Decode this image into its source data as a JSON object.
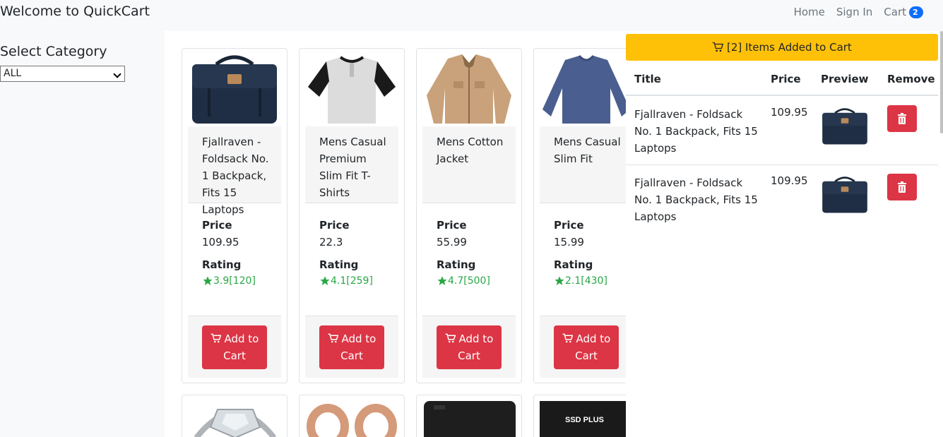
{
  "navbar": {
    "brand": "Welcome to QuickCart",
    "home": "Home",
    "sign_in": "Sign In",
    "cart": "Cart",
    "cart_count": "2"
  },
  "sidebar": {
    "title": "Select Category",
    "selected": "ALL"
  },
  "products": [
    {
      "title": "Fjallraven - Foldsack No. 1 Backpack, Fits 15 Laptops",
      "price_label": "Price",
      "price": "109.95",
      "rating_label": "Rating",
      "rating": "3.9[120]",
      "button": "Add to Cart",
      "image": "backpack"
    },
    {
      "title": "Mens Casual Premium Slim Fit T-Shirts",
      "price_label": "Price",
      "price": "22.3",
      "rating_label": "Rating",
      "rating": "4.1[259]",
      "button": "Add to Cart",
      "image": "tshirt"
    },
    {
      "title": "Mens Cotton Jacket",
      "price_label": "Price",
      "price": "55.99",
      "rating_label": "Rating",
      "rating": "4.7[500]",
      "button": "Add to Cart",
      "image": "jacket"
    },
    {
      "title": "Mens Casual Slim Fit",
      "price_label": "Price",
      "price": "15.99",
      "rating_label": "Rating",
      "rating": "2.1[430]",
      "button": "Add to Cart",
      "image": "longsleeve"
    }
  ],
  "second_row": [
    {
      "image": "ring"
    },
    {
      "image": "gold-rings"
    },
    {
      "image": "hard-drive"
    },
    {
      "image": "ssd",
      "label": "SSD PLUS"
    }
  ],
  "cart_panel": {
    "header": "[2] Items Added to Cart",
    "columns": [
      "Title",
      "Price",
      "Preview",
      "Remove"
    ],
    "items": [
      {
        "title": "Fjallraven - Foldsack No. 1 Backpack, Fits 15 Laptops",
        "price": "109.95"
      },
      {
        "title": "Fjallraven - Foldsack No. 1 Backpack, Fits 15 Laptops",
        "price": "109.95"
      }
    ]
  },
  "colors": {
    "danger": "#dc3545",
    "warning": "#ffc107",
    "success": "#28a745",
    "primary": "#0d6efd"
  }
}
